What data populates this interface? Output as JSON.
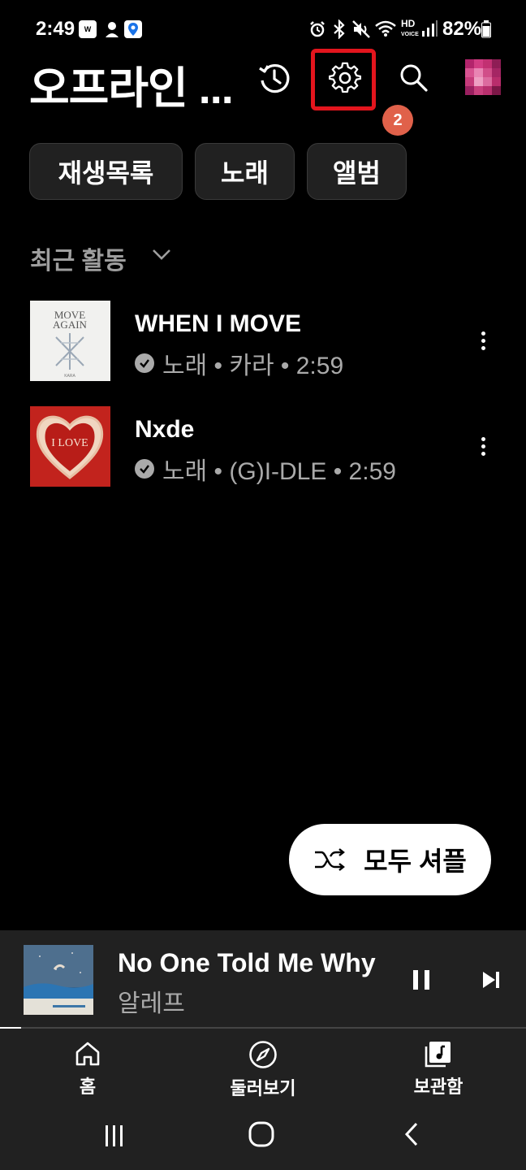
{
  "status_bar": {
    "time": "2:49",
    "battery": "82%",
    "left_icons": [
      "weverse-app-icon",
      "tiktok-style-app-icon",
      "maps-app-icon"
    ],
    "right_icons": [
      "alarm-icon",
      "bluetooth-icon",
      "mute-icon",
      "wifi-icon",
      "hd-voice-icon",
      "signal-icon",
      "battery-icon"
    ]
  },
  "header": {
    "title": "오프라인 ...",
    "actions": [
      "history-icon",
      "settings-icon",
      "search-icon",
      "avatar"
    ],
    "step_badge": "2",
    "highlight_color": "#e3151d"
  },
  "chips": [
    "재생목록",
    "노래",
    "앨범"
  ],
  "recent": {
    "label": "최근 활동",
    "tracks": [
      {
        "title": "WHEN I MOVE",
        "meta": "노래 • 카라 • 2:59",
        "art_lines": [
          "MOVE",
          "AGAIN",
          "KARA"
        ]
      },
      {
        "title": "Nxde",
        "meta": "노래 • (G)I-DLE • 2:59",
        "art_text": "I LOVE"
      }
    ]
  },
  "shuffle_button": {
    "label": "모두 셔플"
  },
  "now_playing": {
    "title": "No One Told Me Why",
    "artist": "알레프",
    "progress": 0.04
  },
  "bottom_nav": [
    {
      "label": "홈",
      "icon": "home-icon"
    },
    {
      "label": "둘러보기",
      "icon": "compass-icon"
    },
    {
      "label": "보관함",
      "icon": "library-icon"
    }
  ],
  "system_nav": [
    "recents-icon",
    "home-circle-icon",
    "back-icon"
  ],
  "colors": {
    "background": "#000000",
    "surface": "#212121",
    "accent_red": "#e3151d",
    "badge": "#e0614a"
  }
}
